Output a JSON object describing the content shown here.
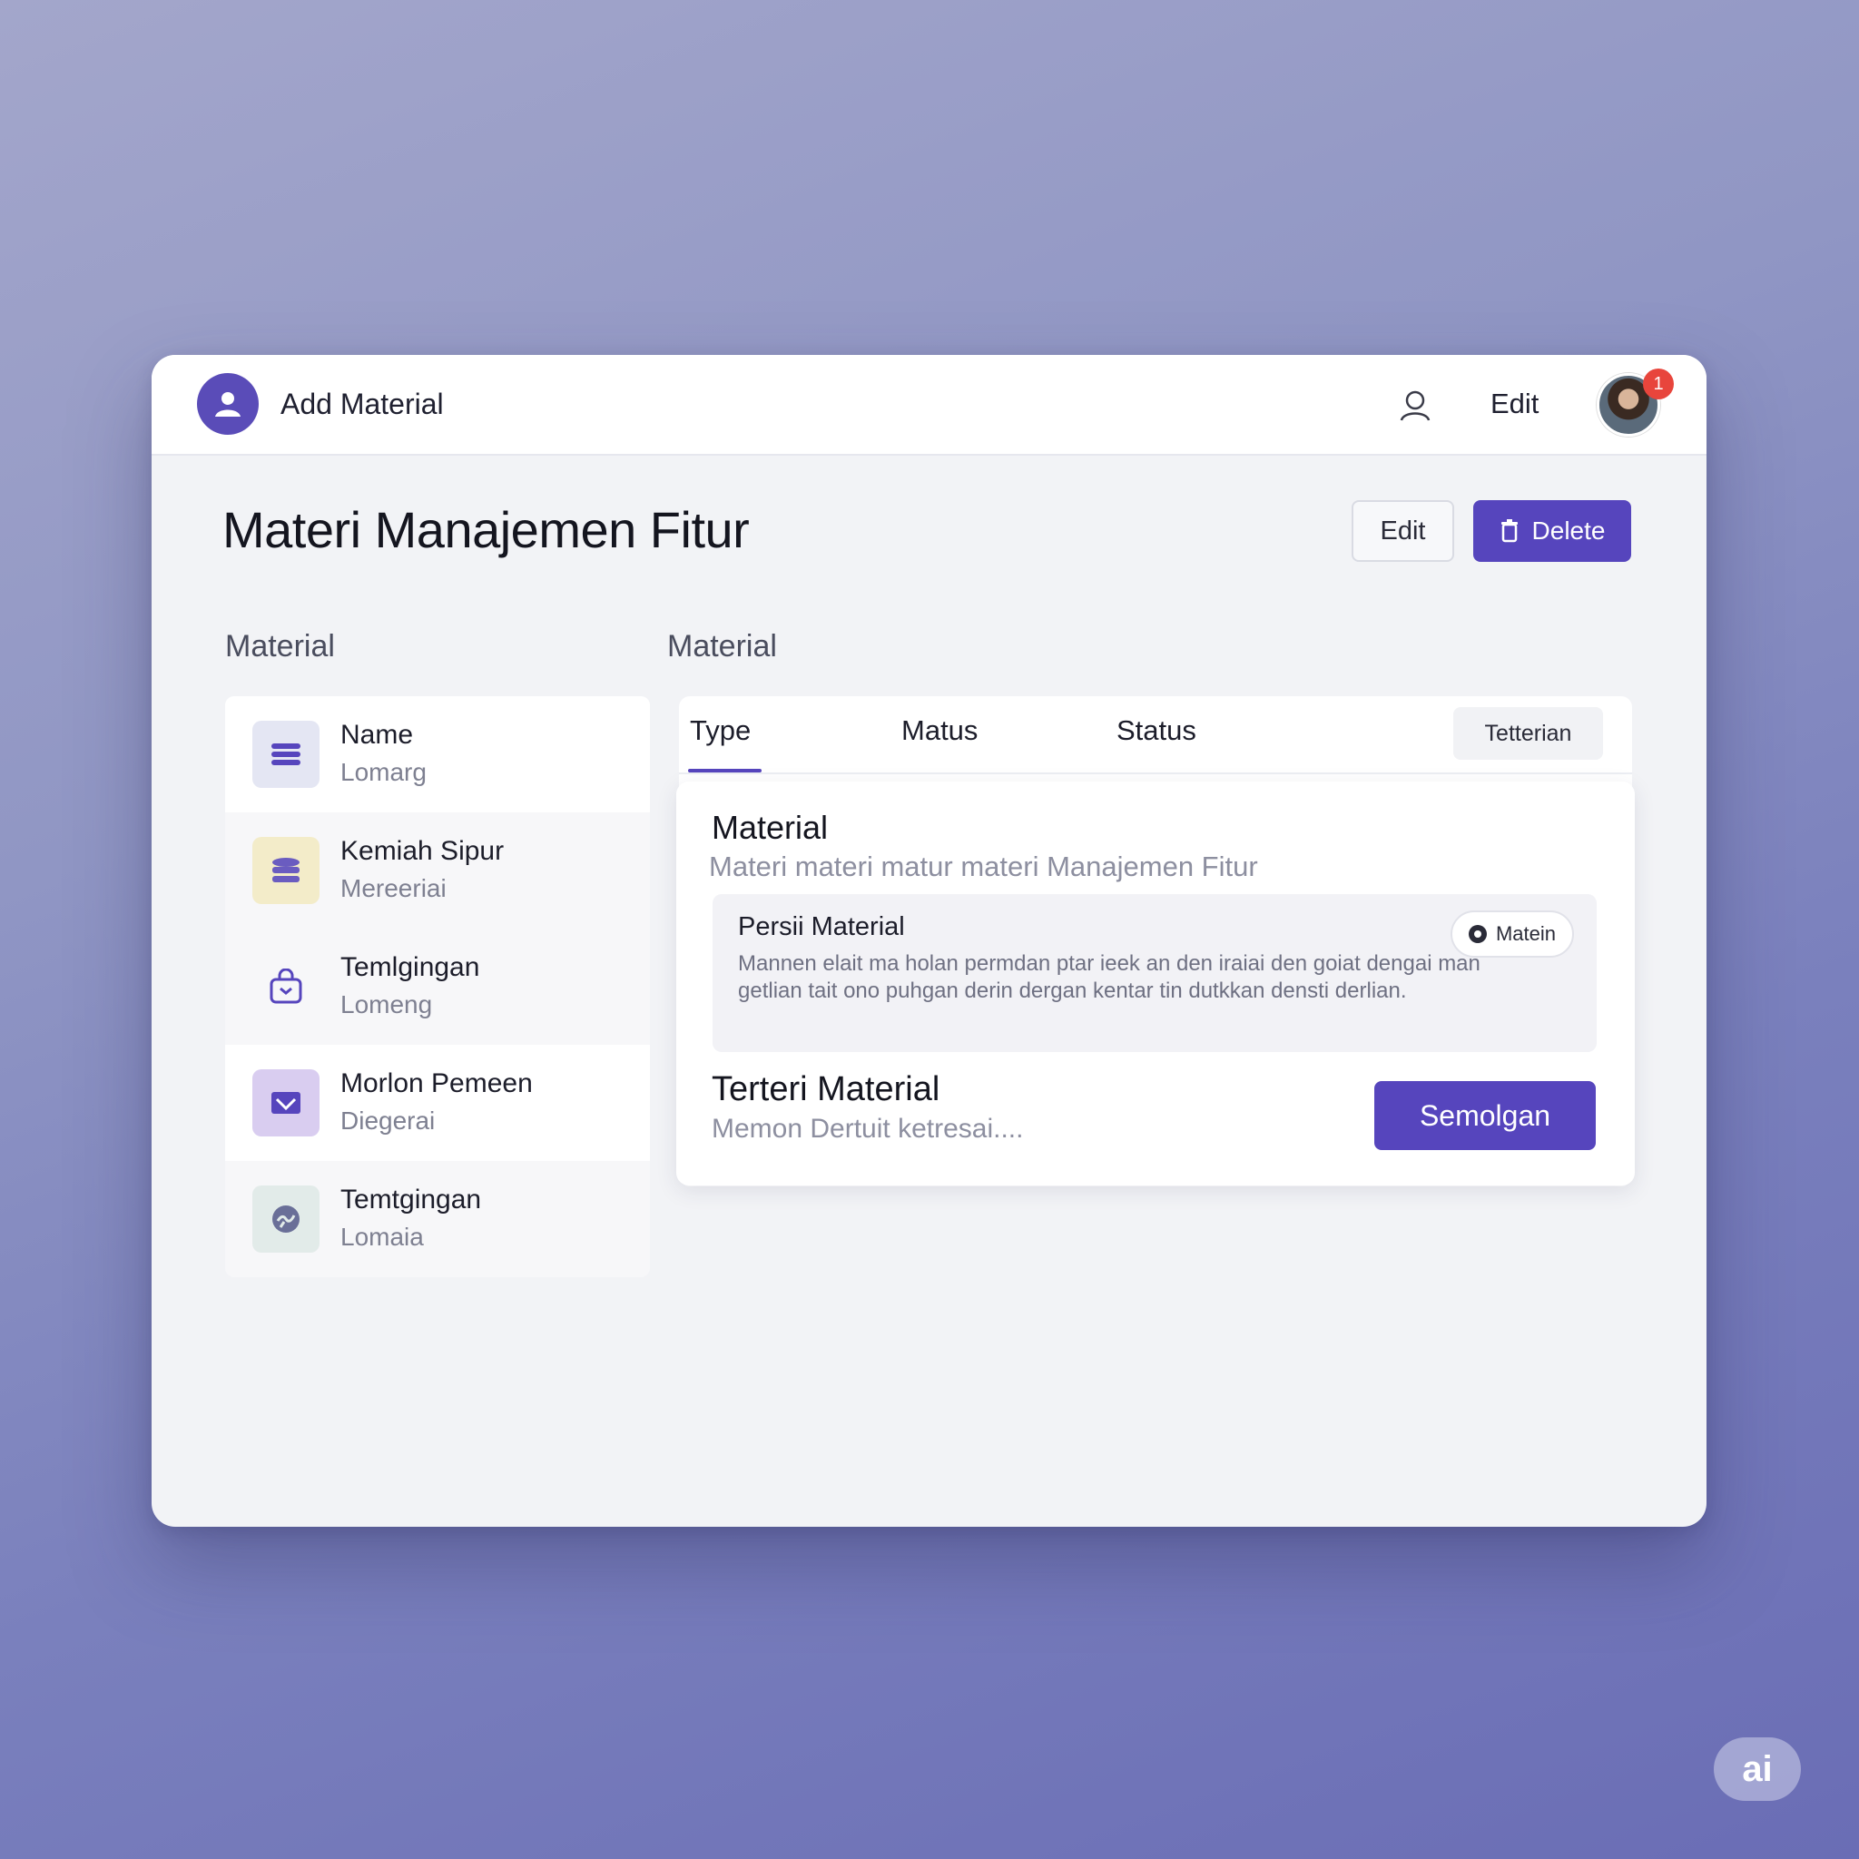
{
  "header": {
    "app_title": "Add Material",
    "edit_label": "Edit",
    "notification_count": "1"
  },
  "page": {
    "title": "Materi Manajemen Fitur",
    "edit_button": "Edit",
    "delete_button": "Delete"
  },
  "sections": {
    "left_label": "Material",
    "right_label": "Material"
  },
  "list": {
    "items": [
      {
        "title": "Name",
        "subtitle": "Lomarg",
        "icon": "stack-icon",
        "color": "#e4e6f3"
      },
      {
        "title": "Kemiah Sipur",
        "subtitle": "Mereeriai",
        "icon": "database-icon",
        "color": "#f3ecc9"
      },
      {
        "title": "Temlgingan",
        "subtitle": "Lomeng",
        "icon": "bag-icon",
        "color": "#f7f7f9"
      },
      {
        "title": "Morlon Pemeen",
        "subtitle": "Diegerai",
        "icon": "envelope-icon",
        "color": "#d9cdf0"
      },
      {
        "title": "Temtgingan",
        "subtitle": "Lomaia",
        "icon": "globe-icon",
        "color": "#e2ebe9"
      }
    ]
  },
  "tabs": {
    "items": [
      "Type",
      "Matus",
      "Status"
    ],
    "active": "Type",
    "pill": "Tetterian"
  },
  "detail": {
    "title": "Material",
    "subtitle": "Materi materi matur materi Manajemen Fitur",
    "box_title": "Persii Material",
    "box_description": "Mannen elait ma holan permdan ptar ieek an den iraiai den goiat dengai man getlian tait ono puhgan derin dergan kentar tin dutkkan densti derlian.",
    "chip_label": "Matein",
    "section_title": "Terteri Material",
    "section_subtitle": "Memon Dertuit ketresai....",
    "primary_button": "Semolgan"
  },
  "colors": {
    "accent": "#5645bd",
    "badge": "#e8453c"
  },
  "watermark": "ai"
}
